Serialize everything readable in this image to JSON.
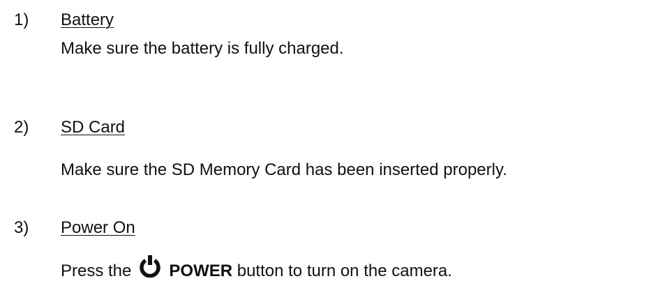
{
  "steps": [
    {
      "number": "1)",
      "heading": "Battery",
      "text": "Make sure the battery is fully charged."
    },
    {
      "number": "2)",
      "heading": "SD Card",
      "text": "Make sure the SD Memory Card has been inserted properly."
    },
    {
      "number": "3)",
      "heading": "Power On",
      "text_before": "Press the",
      "icon": "power-icon",
      "bold_word": "POWER",
      "text_after": "button to turn on the camera."
    }
  ]
}
